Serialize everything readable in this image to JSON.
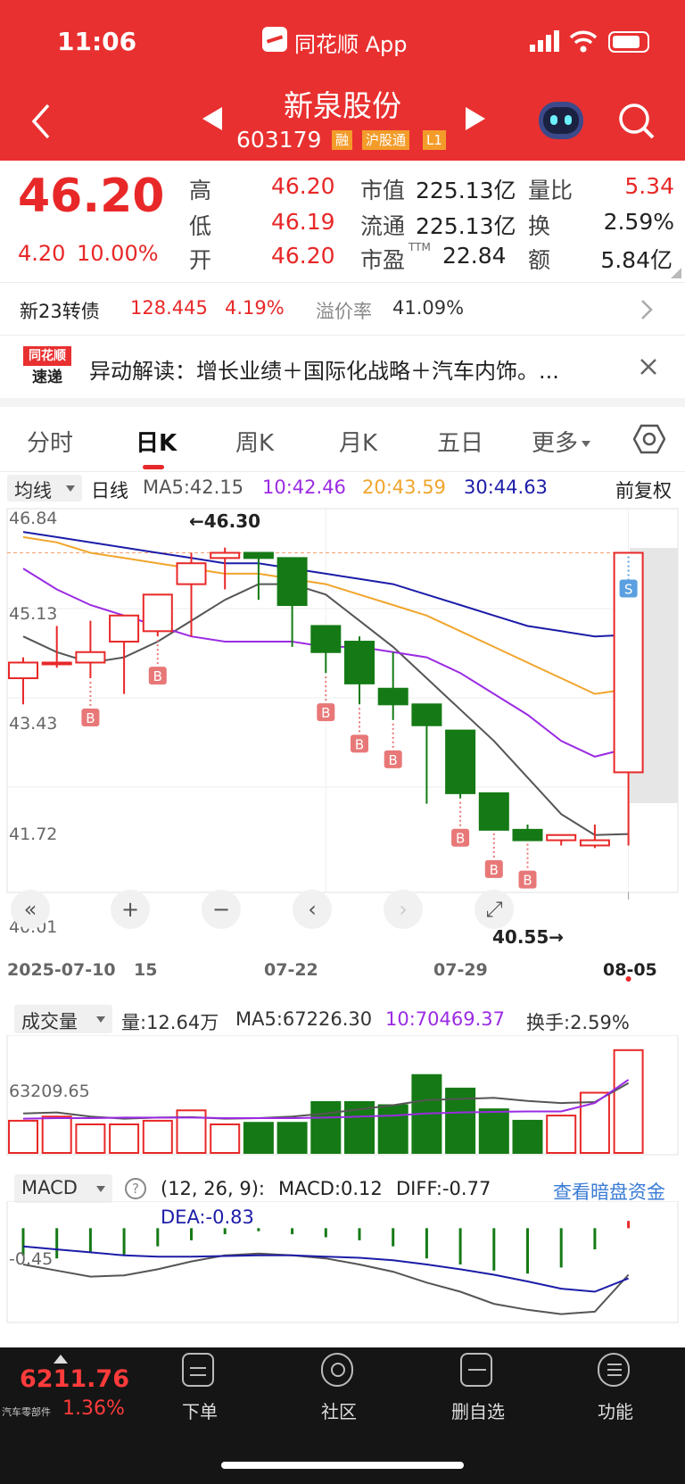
{
  "status_bar": {
    "time": "11:06",
    "app_name": "同花顺 App"
  },
  "header": {
    "stock_name": "新泉股份",
    "stock_code": "603179",
    "badges": [
      "融",
      "沪股通",
      "L1"
    ]
  },
  "quote": {
    "price": "46.20",
    "change": "4.20",
    "change_pct": "10.00%",
    "labels": {
      "high": "高",
      "low": "低",
      "open": "开",
      "mkt_cap": "市值",
      "float_cap": "流通",
      "pe": "市盈",
      "pe_sup": "TTM",
      "vol_ratio": "量比",
      "turnover": "换",
      "amount": "额"
    },
    "values": {
      "high": "46.20",
      "low": "46.19",
      "open": "46.20",
      "mkt_cap": "225.13亿",
      "float_cap": "225.13亿",
      "pe": "22.84",
      "vol_ratio": "5.34",
      "turnover": "2.59%",
      "amount": "5.84亿"
    }
  },
  "bond": {
    "name": "新23转债",
    "price": "128.445",
    "change": "4.19%",
    "premium_label": "溢价率",
    "premium": "41.09%"
  },
  "news": {
    "logo_top": "同花顺",
    "logo_bottom": "速递",
    "text": "异动解读：增长业绩＋国际化战略＋汽车内饰。..."
  },
  "tabs": [
    "分时",
    "日K",
    "周K",
    "月K",
    "五日",
    "更多"
  ],
  "active_tab": "日K",
  "ma_legend": {
    "selector": "均线",
    "period": "日线",
    "ma5": "MA5:42.15",
    "ma10": "10:42.46",
    "ma20": "20:43.59",
    "ma30": "30:44.63",
    "adjust": "前复权"
  },
  "price_axis": [
    "46.84",
    "45.13",
    "43.43",
    "41.72",
    "40.01"
  ],
  "annotations": {
    "high": "←46.30",
    "low": "40.55→"
  },
  "date_axis": [
    "2025-07-10",
    "15",
    "07-22",
    "07-29",
    "08-05"
  ],
  "volume": {
    "selector": "成交量",
    "vol": "量:12.64万",
    "ma5": "MA5:67226.30",
    "ma10": "10:70469.37",
    "turnover": "换手:2.59%",
    "axis_label": "63209.65"
  },
  "macd": {
    "selector": "MACD",
    "params": "(12, 26, 9):",
    "macd": "MACD:0.12",
    "diff": "DIFF:-0.77",
    "dea": "DEA:-0.83",
    "link": "查看暗盘资金",
    "axis_label": "-0.45"
  },
  "bottom_bar": {
    "index_value": "6211.76",
    "index_name": "汽车零部件",
    "index_change": "1.36%",
    "buttons": [
      "下单",
      "社区",
      "删自选",
      "功能"
    ]
  },
  "colors": {
    "header_bg": "#e93030",
    "up": "#e82828",
    "down": "#157a15",
    "ma5": "#555555",
    "ma10": "#9b2be3",
    "ma20": "#f0a52c",
    "ma30": "#1c1ca8"
  },
  "chart_data": {
    "type": "candlestick",
    "dates": [
      "2025-07-10",
      "2025-07-11",
      "2025-07-14",
      "2025-07-15",
      "2025-07-16",
      "2025-07-17",
      "2025-07-18",
      "2025-07-21",
      "2025-07-22",
      "2025-07-23",
      "2025-07-24",
      "2025-07-25",
      "2025-07-28",
      "2025-07-29",
      "2025-07-30",
      "2025-07-31",
      "2025-08-01",
      "2025-08-04",
      "2025-08-05"
    ],
    "open": [
      43.8,
      44.1,
      44.1,
      44.5,
      44.7,
      45.6,
      46.1,
      46.2,
      46.1,
      44.8,
      44.5,
      43.6,
      43.3,
      42.8,
      41.6,
      40.9,
      40.7,
      40.6,
      42.0
    ],
    "high": [
      44.2,
      44.8,
      44.9,
      45.0,
      45.4,
      46.2,
      46.3,
      46.2,
      46.1,
      44.8,
      44.6,
      44.3,
      43.1,
      42.8,
      41.6,
      41.0,
      40.8,
      41.0,
      46.2
    ],
    "low": [
      43.3,
      44.0,
      43.8,
      43.5,
      44.6,
      44.6,
      45.5,
      45.3,
      44.4,
      43.9,
      43.3,
      43.0,
      41.4,
      41.5,
      40.9,
      40.7,
      40.6,
      40.55,
      40.6
    ],
    "close": [
      44.1,
      44.1,
      44.3,
      45.0,
      45.4,
      46.0,
      46.2,
      46.1,
      45.2,
      44.3,
      43.7,
      43.3,
      42.9,
      41.6,
      40.9,
      40.7,
      40.8,
      40.7,
      46.2
    ],
    "ma5": [
      44.6,
      44.3,
      44.1,
      44.2,
      44.5,
      44.9,
      45.3,
      45.6,
      45.6,
      45.4,
      44.9,
      44.4,
      43.8,
      43.2,
      42.6,
      41.9,
      41.2,
      40.8,
      40.82
    ],
    "ma10": [
      45.9,
      45.5,
      45.2,
      45.0,
      44.8,
      44.6,
      44.5,
      44.5,
      44.5,
      44.4,
      44.4,
      44.3,
      44.2,
      43.9,
      43.5,
      43.1,
      42.6,
      42.3,
      42.46
    ],
    "ma20": [
      46.5,
      46.4,
      46.2,
      46.1,
      46.0,
      45.9,
      45.8,
      45.8,
      45.7,
      45.6,
      45.4,
      45.2,
      45.0,
      44.7,
      44.4,
      44.1,
      43.8,
      43.5,
      43.59
    ],
    "ma30": [
      46.6,
      46.5,
      46.4,
      46.3,
      46.2,
      46.1,
      46.0,
      46.0,
      45.9,
      45.8,
      45.7,
      45.6,
      45.4,
      45.2,
      45.0,
      44.8,
      44.7,
      44.6,
      44.63
    ],
    "b_signals": [
      "2025-07-14",
      "2025-07-16",
      "2025-07-23",
      "2025-07-24",
      "2025-07-25",
      "2025-07-29",
      "2025-07-30",
      "2025-07-31"
    ],
    "s_signals": [
      "2025-08-05"
    ],
    "y_range": [
      40.01,
      46.84
    ],
    "volume": [
      31000,
      35000,
      27500,
      27500,
      31000,
      41000,
      27500,
      29000,
      29000,
      49000,
      49000,
      46000,
      75000,
      62000,
      42000,
      31000,
      36000,
      58000,
      99000
    ],
    "volume_ma5": [
      38000,
      39000,
      35000,
      33000,
      34000,
      34500,
      33000,
      33500,
      35000,
      38000,
      42000,
      46000,
      51000,
      52000,
      53000,
      50000,
      48000,
      49000,
      67226
    ],
    "volume_ma10": [
      33000,
      33500,
      33500,
      34000,
      34000,
      34000,
      33500,
      33500,
      33500,
      34000,
      35000,
      36000,
      38000,
      39000,
      39500,
      40000,
      40000,
      48000,
      70469
    ],
    "volume_y_range": [
      0,
      110000
    ],
    "macd_hist": [
      -0.45,
      -0.5,
      -0.4,
      -0.45,
      -0.3,
      -0.2,
      -0.1,
      -0.05,
      -0.1,
      -0.15,
      -0.2,
      -0.3,
      -0.5,
      -0.6,
      -0.7,
      -0.75,
      -0.65,
      -0.35,
      0.12
    ],
    "diff": [
      -0.6,
      -0.7,
      -0.8,
      -0.78,
      -0.68,
      -0.55,
      -0.45,
      -0.42,
      -0.45,
      -0.5,
      -0.6,
      -0.72,
      -0.9,
      -1.05,
      -1.25,
      -1.35,
      -1.42,
      -1.38,
      -0.77
    ],
    "dea": [
      -0.3,
      -0.35,
      -0.4,
      -0.45,
      -0.47,
      -0.47,
      -0.46,
      -0.45,
      -0.45,
      -0.47,
      -0.49,
      -0.53,
      -0.6,
      -0.68,
      -0.77,
      -0.88,
      -1.0,
      -1.05,
      -0.83
    ],
    "macd_y_range": [
      -1.5,
      0.3
    ]
  }
}
